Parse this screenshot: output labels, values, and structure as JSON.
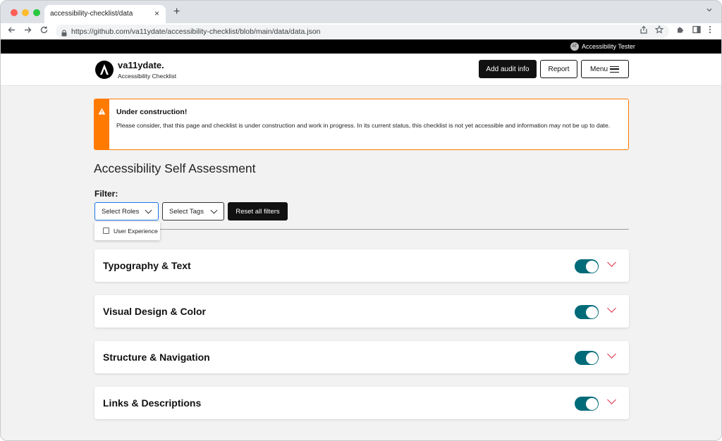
{
  "browser": {
    "tab_title": "accessibility-checklist/data",
    "tab_close": "×",
    "new_tab": "+",
    "url": "https://github.com/va11ydate/accessibility-checklist/blob/main/data/data.json"
  },
  "topbar": {
    "avatar_initials": "AT",
    "user_name": "Accessibility Tester"
  },
  "header": {
    "brand": "va11ydate.",
    "subtitle": "Accessibility Checklist",
    "add_audit_label": "Add audit info",
    "report_label": "Report",
    "menu_label": "Menu"
  },
  "alert": {
    "title": "Under construction!",
    "text": "Please consider, that this page and checklist is under construction and work in progress. In its current status, this checklist is not yet accessible and information may not be up to date.",
    "color": "#ff7a00"
  },
  "main": {
    "title": "Accessibility Self Assessment",
    "filter_label": "Filter:",
    "roles_select": "Select Roles",
    "tags_select": "Select Tags",
    "reset_label": "Reset all filters",
    "roles_options": [
      {
        "label": "User Experience",
        "checked": false
      }
    ]
  },
  "categories": [
    {
      "title": "Typography & Text",
      "enabled": true
    },
    {
      "title": "Visual Design & Color",
      "enabled": true
    },
    {
      "title": "Structure & Navigation",
      "enabled": true
    },
    {
      "title": "Links & Descriptions",
      "enabled": true
    }
  ],
  "colors": {
    "toggle_on": "#006b78",
    "chevron": "#e0304a",
    "focus": "#1a73e8"
  }
}
